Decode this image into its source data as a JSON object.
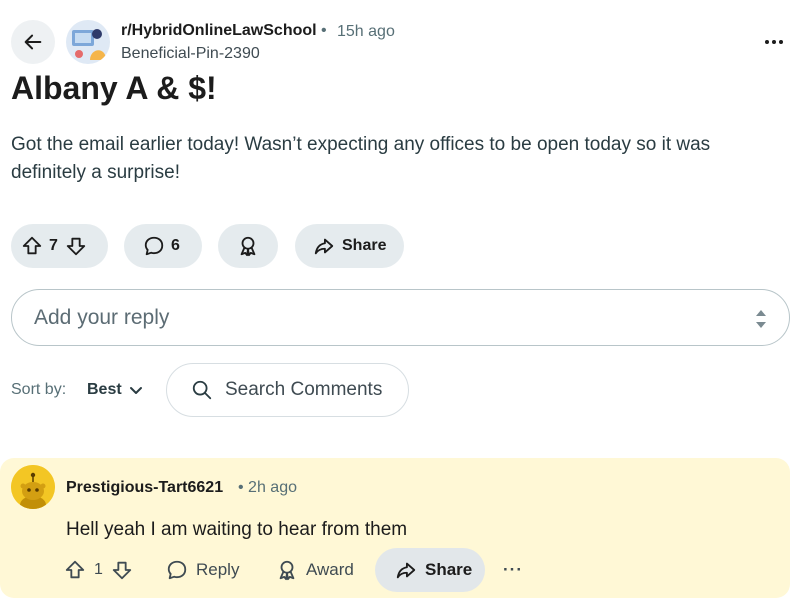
{
  "header": {
    "subreddit": "r/HybridOnlineLawSchool",
    "separator": "•",
    "time": "15h ago",
    "author": "Beneficial-Pin-2390",
    "more": "•••"
  },
  "post": {
    "title": "Albany A & $!",
    "body": "Got the email earlier today! Wasn’t expecting any offices to be open today so it was definitely a surprise!"
  },
  "actions": {
    "vote_count": "7",
    "comment_count": "6",
    "share_label": "Share"
  },
  "reply": {
    "placeholder": "Add your reply"
  },
  "sort": {
    "label": "Sort by:",
    "value": "Best"
  },
  "search": {
    "placeholder": "Search Comments"
  },
  "comment": {
    "author": "Prestigious-Tart6621",
    "time": "• 2h ago",
    "text": "Hell yeah I am waiting to hear from them",
    "vote_count": "1",
    "reply_label": "Reply",
    "award_label": "Award",
    "share_label": "Share",
    "more": "···"
  },
  "icons": {
    "back": "arrow-left-icon",
    "upvote": "arrow-up-icon",
    "downvote": "arrow-down-icon",
    "comment": "speech-bubble-icon",
    "award": "award-ribbon-icon",
    "share": "share-arrow-icon",
    "search": "search-icon",
    "chevron": "chevron-down-icon",
    "stepper": "up-down-arrows-icon"
  },
  "colors": {
    "pill_bg": "#e5ebee",
    "comment_bg": "#fff8d6",
    "avatar_yellow": "#f3c624",
    "meta_text": "#576f76"
  }
}
